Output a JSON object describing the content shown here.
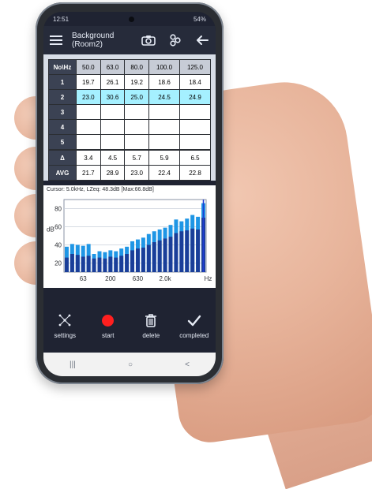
{
  "status": {
    "time": "12:51",
    "battery": "54%"
  },
  "header": {
    "title_line1": "Background",
    "title_line2": "(Room2)",
    "icons": [
      "menu-icon",
      "camera-icon",
      "settings-dots-icon",
      "back-arrow-icon"
    ]
  },
  "table": {
    "corner": "No\\Hz",
    "columns": [
      "50.0",
      "63.0",
      "80.0",
      "100.0",
      "125.0"
    ],
    "rows": [
      {
        "label": "1",
        "values": [
          "19.7",
          "26.1",
          "19.2",
          "18.6",
          "18.4"
        ],
        "highlight": false
      },
      {
        "label": "2",
        "values": [
          "23.0",
          "30.6",
          "25.0",
          "24.5",
          "24.9"
        ],
        "highlight": true
      },
      {
        "label": "3",
        "values": [
          "",
          "",
          "",
          "",
          ""
        ],
        "highlight": false
      },
      {
        "label": "4",
        "values": [
          "",
          "",
          "",
          "",
          ""
        ],
        "highlight": false
      },
      {
        "label": "5",
        "values": [
          "",
          "",
          "",
          "",
          ""
        ],
        "highlight": false
      }
    ],
    "delta": {
      "label": "Δ",
      "values": [
        "3.4",
        "4.5",
        "5.7",
        "5.9",
        "6.5"
      ]
    },
    "avg": {
      "label": "AVG",
      "values": [
        "21.7",
        "28.9",
        "23.0",
        "22.4",
        "22.8"
      ]
    }
  },
  "chart": {
    "cursor_text": "Cursor: 5.0kHz,    LZeq: 48.3dB  [Max:66.8dB]",
    "y_axis_label": "dB",
    "y_ticks": [
      "80",
      "60",
      "40",
      "20"
    ],
    "x_ticks": [
      "63",
      "200",
      "630",
      "2.0k",
      "Hz"
    ]
  },
  "chart_data": {
    "type": "bar",
    "ylim": [
      10,
      90
    ],
    "categories": [
      "",
      "",
      "",
      "",
      "",
      "",
      "",
      "",
      "",
      "",
      "",
      "",
      "",
      "",
      "",
      "",
      "",
      "",
      "",
      "",
      "",
      "",
      "",
      "",
      "",
      ""
    ],
    "series": [
      {
        "values": [
          38,
          41,
          40,
          39,
          41,
          30,
          33,
          32,
          34,
          33,
          36,
          38,
          44,
          46,
          48,
          52,
          55,
          57,
          59,
          62,
          68,
          66,
          69,
          73,
          71,
          86
        ]
      },
      {
        "values": [
          26,
          30,
          29,
          27,
          28,
          25,
          26,
          25,
          27,
          26,
          28,
          30,
          34,
          36,
          37,
          40,
          43,
          45,
          47,
          49,
          53,
          55,
          56,
          58,
          57,
          70
        ]
      }
    ],
    "colors": {
      "series_top": "#1f96e5",
      "series_base": "#1a3e99",
      "cursor": "#1f3bd4"
    }
  },
  "actions": [
    {
      "label": "settings",
      "icon": "scatter-settings-icon"
    },
    {
      "label": "start",
      "icon": "record-icon"
    },
    {
      "label": "delete",
      "icon": "trash-icon"
    },
    {
      "label": "completed",
      "icon": "check-icon"
    }
  ],
  "navbar": {
    "recent": "|||",
    "home": "○",
    "back": "<"
  }
}
